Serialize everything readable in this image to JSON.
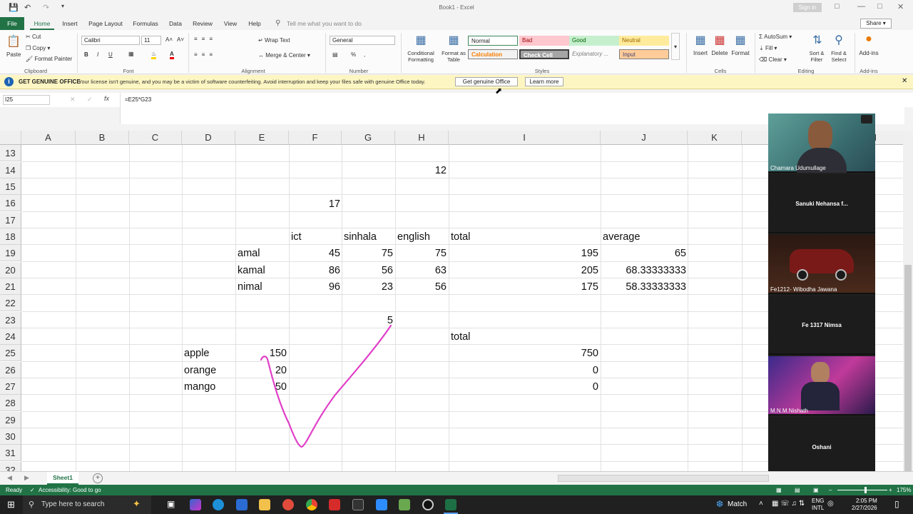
{
  "window": {
    "title": "Book1  -  Excel",
    "signin": "Sign in"
  },
  "tabs": [
    "File",
    "Home",
    "Insert",
    "Page Layout",
    "Formulas",
    "Data",
    "Review",
    "View",
    "Help"
  ],
  "tell_me": "Tell me what you want to do",
  "share": "Share",
  "ribbon": {
    "clipboard": {
      "paste": "Paste",
      "cut": "Cut",
      "copy": "Copy",
      "format_painter": "Format Painter",
      "label": "Clipboard"
    },
    "font": {
      "name": "Calibri",
      "size": "11",
      "label": "Font",
      "bold": "B",
      "italic": "I",
      "underline": "U"
    },
    "alignment": {
      "wrap": "Wrap Text",
      "merge": "Merge & Center",
      "label": "Alignment"
    },
    "number": {
      "format": "General",
      "label": "Number",
      "pct": "%",
      "comma": ","
    },
    "styles": {
      "conditional": "Conditional Formatting",
      "format_table": "Format as Table",
      "label": "Styles",
      "normal": "Normal",
      "bad": "Bad",
      "good": "Good",
      "neutral": "Neutral",
      "calculation": "Calculation",
      "check": "Check Cell",
      "explanatory": "Explanatory ...",
      "input": "Input"
    },
    "cells": {
      "insert": "Insert",
      "delete": "Delete",
      "format": "Format",
      "label": "Cells"
    },
    "editing": {
      "autosum": "AutoSum",
      "fill": "Fill",
      "clear": "Clear",
      "sort": "Sort & Filter",
      "find": "Find & Select",
      "label": "Editing"
    },
    "addins": {
      "addins": "Add-ins",
      "label": "Add-ins"
    }
  },
  "message": {
    "title": "GET GENUINE OFFICE",
    "text": "Your license isn't genuine, and you may be a victim of software counterfeiting. Avoid interruption and keep your files safe with genuine Office today.",
    "btn1": "Get genuine Office",
    "btn2": "Learn more"
  },
  "namebox": "I25",
  "formula": "=E25*G23",
  "columns": [
    "A",
    "B",
    "C",
    "D",
    "E",
    "F",
    "G",
    "H",
    "I",
    "J",
    "K",
    "L",
    "N"
  ],
  "rows": [
    "13",
    "14",
    "15",
    "16",
    "17",
    "18",
    "19",
    "20",
    "21",
    "22",
    "23",
    "24",
    "25",
    "26",
    "27",
    "28",
    "29",
    "30",
    "31",
    "32"
  ],
  "cells": {
    "h14": "12",
    "f16": "17",
    "f18": "ict",
    "g18": "sinhala",
    "h18": "english",
    "i18": "total",
    "j18": "average",
    "e19": "amal",
    "f19": "45",
    "g19": "75",
    "h19": "75",
    "i19": "195",
    "j19": "65",
    "e20": "kamal",
    "f20": "86",
    "g20": "56",
    "h20": "63",
    "i20": "205",
    "j20": "68.33333333",
    "e21": "nimal",
    "f21": "96",
    "g21": "23",
    "h21": "56",
    "i21": "175",
    "j21": "58.33333333",
    "g23": "5",
    "i24": "total",
    "d25": "apple",
    "e25": "150",
    "i25": "750",
    "d26": "orange",
    "e26": "20",
    "i26": "0",
    "d27": "mango",
    "e27": "50",
    "i27": "0"
  },
  "participants": [
    "Chamara Udumullage",
    "Sanuki  Nehansa  f...",
    "Fe1212- Wibodha Jawana",
    "Fe 1317 Nimsa",
    "M.N.M.Nishath",
    "Oshani"
  ],
  "sheet": "Sheet1",
  "status": {
    "ready": "Ready",
    "accessibility": "Accessibility: Good to go",
    "zoom": "175%"
  },
  "taskbar": {
    "search": "Type here to search",
    "weather": "Match",
    "lang1": "ENG",
    "lang2": "INTL",
    "time": "2:05 PM",
    "date": "2/27/2026"
  }
}
